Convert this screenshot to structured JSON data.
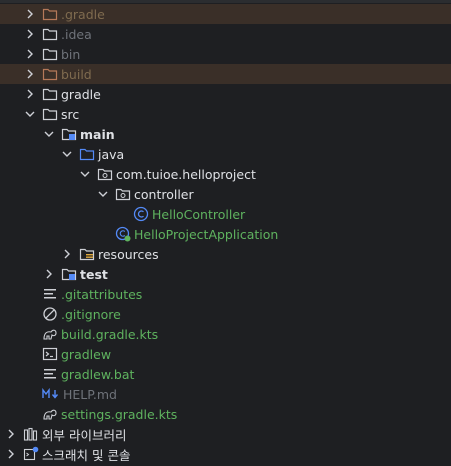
{
  "tree": {
    "gradle_dir": ".gradle",
    "idea_dir": ".idea",
    "bin_dir": "bin",
    "build_dir": "build",
    "gradle_folder": "gradle",
    "src_folder": "src",
    "main_folder": "main",
    "java_folder": "java",
    "package": "com.tuioe.helloproject",
    "controller_folder": "controller",
    "hello_controller": "HelloController",
    "app_class": "HelloProjectApplication",
    "resources_folder": "resources",
    "test_folder": "test",
    "gitattributes": ".gitattributes",
    "gitignore": ".gitignore",
    "build_gradle_kts": "build.gradle.kts",
    "gradlew": "gradlew",
    "gradlew_bat": "gradlew.bat",
    "help_md": "HELP.md",
    "settings_gradle_kts": "settings.gradle.kts",
    "external_libraries": "외부 라이브러리",
    "scratches": "스크래치 및 콘솔"
  },
  "icons": {
    "folder": "folder-icon",
    "source_folder": "source-folder-icon",
    "module_folder": "module-folder-icon",
    "package": "package-icon",
    "class": "class-icon",
    "spring_app": "spring-app-icon",
    "text_file": "text-file-icon",
    "ignore_file": "ignore-file-icon",
    "gradle_file": "gradle-file-icon",
    "shell_file": "shell-file-icon",
    "markdown_file": "markdown-file-icon",
    "library": "library-icon",
    "scratch": "scratch-icon"
  },
  "colors": {
    "background": "#1e1f22",
    "excluded_row_bg": "#3a2f28",
    "excluded_text": "#7f6b4f",
    "text": "#dfe1e5",
    "untracked_green": "#5fb35f",
    "ignored_gray": "#6f737a",
    "accent_blue": "#548af7"
  }
}
